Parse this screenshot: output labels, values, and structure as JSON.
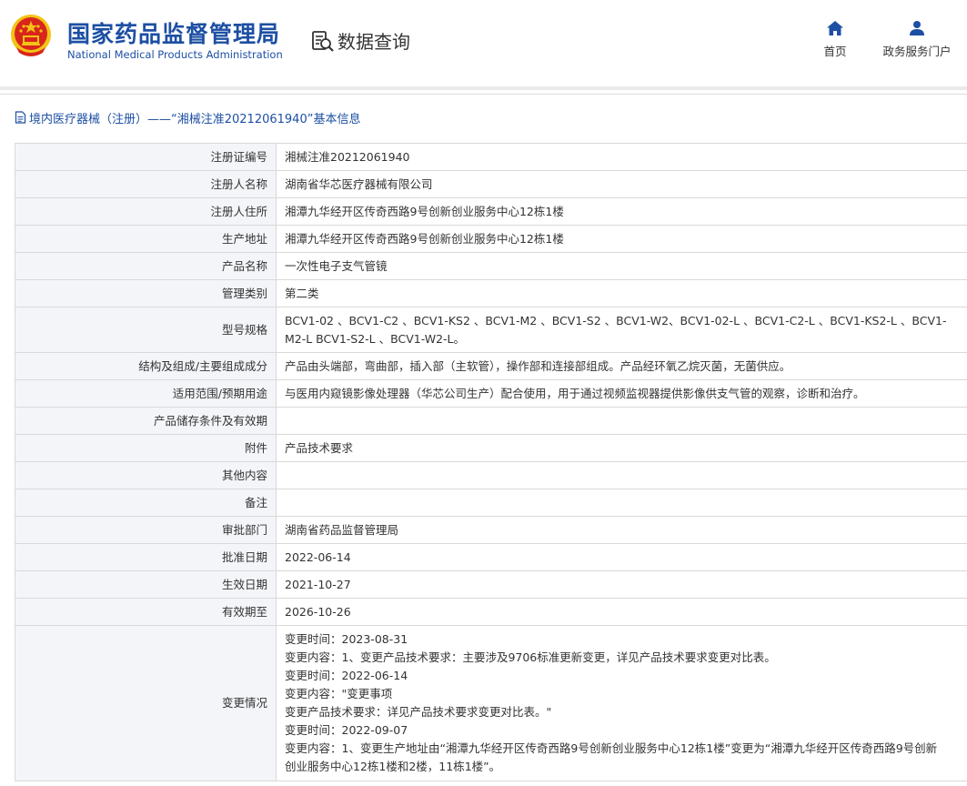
{
  "header": {
    "org_name_cn": "国家药品监督管理局",
    "org_name_en": "National Medical Products Administration",
    "query_label": "数据查询",
    "nav": {
      "home_label": "首页",
      "portal_label": "政务服务门户"
    }
  },
  "page": {
    "title": "境内医疗器械（注册）——“湘械注准20212061940”基本信息"
  },
  "record": {
    "rows": [
      {
        "key": "注册证编号",
        "value": "湘械注准20212061940"
      },
      {
        "key": "注册人名称",
        "value": "湖南省华芯医疗器械有限公司"
      },
      {
        "key": "注册人住所",
        "value": "湘潭九华经开区传奇西路9号创新创业服务中心12栋1楼"
      },
      {
        "key": "生产地址",
        "value": "湘潭九华经开区传奇西路9号创新创业服务中心12栋1楼"
      },
      {
        "key": "产品名称",
        "value": "一次性电子支气管镜"
      },
      {
        "key": "管理类别",
        "value": "第二类"
      },
      {
        "key": "型号规格",
        "value": "BCV1-02 、BCV1-C2 、BCV1-KS2 、BCV1-M2 、BCV1-S2 、BCV1-W2、BCV1-02-L 、BCV1-C2-L 、BCV1-KS2-L 、BCV1-M2-L BCV1-S2-L 、BCV1-W2-L。"
      },
      {
        "key": "结构及组成/主要组成成分",
        "value": "产品由头端部，弯曲部，插入部（主软管），操作部和连接部组成。产品经环氧乙烷灭菌，无菌供应。"
      },
      {
        "key": "适用范围/预期用途",
        "value": "与医用内窥镜影像处理器（华芯公司生产）配合使用，用于通过视频监视器提供影像供支气管的观察，诊断和治疗。"
      },
      {
        "key": "产品储存条件及有效期",
        "value": ""
      },
      {
        "key": "附件",
        "value": "产品技术要求"
      },
      {
        "key": "其他内容",
        "value": ""
      },
      {
        "key": "备注",
        "value": ""
      },
      {
        "key": "审批部门",
        "value": "湖南省药品监督管理局"
      },
      {
        "key": "批准日期",
        "value": "2022-06-14"
      },
      {
        "key": "生效日期",
        "value": "2021-10-27"
      },
      {
        "key": "有效期至",
        "value": "2026-10-26"
      }
    ],
    "change_key": "变更情况",
    "change_lines": [
      "变更时间：2023-08-31",
      "变更内容：1、变更产品技术要求：主要涉及9706标准更新变更，详见产品技术要求变更对比表。",
      "变更时间：2022-06-14",
      "变更内容：\"变更事项",
      "变更产品技术要求：详见产品技术要求变更对比表。\"",
      "变更时间：2022-09-07",
      "变更内容：1、变更生产地址由“湘潭九华经开区传奇西路9号创新创业服务中心12栋1楼”变更为“湘潭九华经开区传奇西路9号创新",
      "创业服务中心12栋1楼和2楼，11栋1楼”。"
    ]
  },
  "colors": {
    "brand_blue": "#1d4fa3",
    "emblem_red": "#d8261c",
    "emblem_gold": "#f3c316",
    "key_bg": "#f3f5f8",
    "border": "#d9d9d9"
  },
  "icons": {
    "emblem": "national-emblem-icon",
    "query": "data-query-icon",
    "home": "home-icon",
    "portal": "user-icon",
    "title": "document-icon"
  }
}
